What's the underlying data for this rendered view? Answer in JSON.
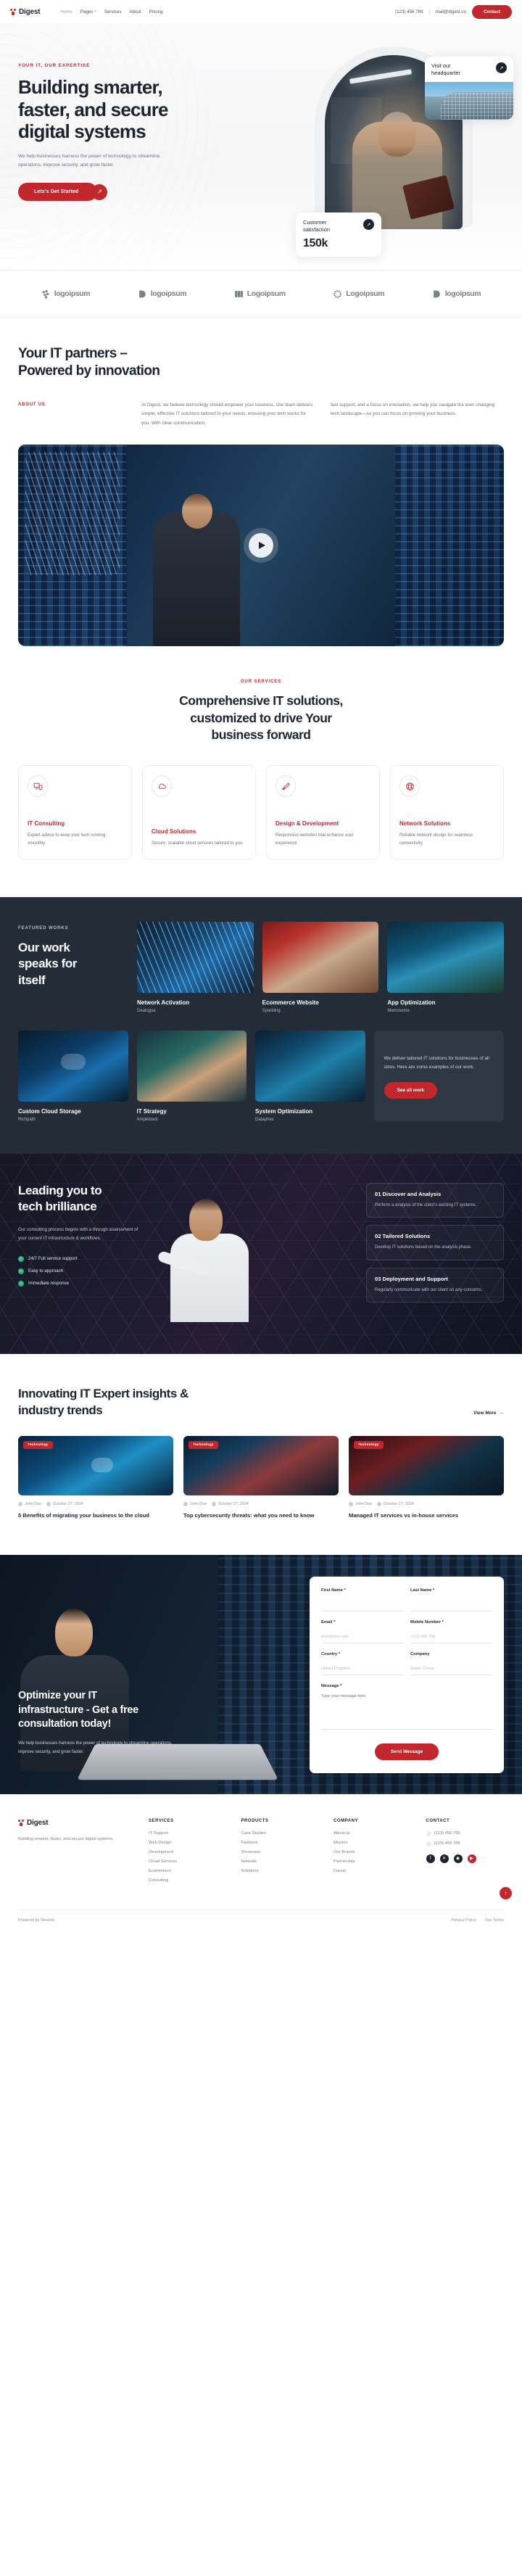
{
  "brand": {
    "name": "Digest",
    "logo_icon": "digest-logo-icon"
  },
  "nav": {
    "links": [
      {
        "label": "Home",
        "has_caret": false
      },
      {
        "label": "Pages",
        "has_caret": true
      },
      {
        "label": "Services",
        "has_caret": false
      },
      {
        "label": "About",
        "has_caret": false
      },
      {
        "label": "Pricing",
        "has_caret": false
      }
    ],
    "phone": "(123) 456 789",
    "email": "mail@digest.co",
    "contact_button": "Contact"
  },
  "hero": {
    "eyebrow": "YOUR IT, OUR EXPERTISE",
    "title_line1": "Building smarter,",
    "title_line2": "faster, and secure",
    "title_line3": "digital systems",
    "subtitle": "We help businesses harness the power of technology to streamline operations, improve security, and grow faster.",
    "cta_label": "Lets's Get Started",
    "cta_arrow": "arrow-up-right-icon",
    "hq_card": {
      "title_line1": "Visit our",
      "title_line2": "headquarter",
      "arrow": "arrow-up-right-icon"
    },
    "stat_card": {
      "label_line1": "Customer",
      "label_line2": "satisfaction",
      "value": "150k",
      "arrow": "arrow-up-right-icon"
    }
  },
  "logos": [
    {
      "name": "logoipsum",
      "glyph": "dots-cluster-icon"
    },
    {
      "name": "logoipsum",
      "glyph": "half-circle-icon"
    },
    {
      "name": "Logoipsum",
      "glyph": "chevron-bars-icon"
    },
    {
      "name": "Logoipsum",
      "glyph": "sun-burst-icon"
    },
    {
      "name": "logoipsum",
      "glyph": "half-circle-icon"
    }
  ],
  "about": {
    "title_line1": "Your IT partners –",
    "title_line2": "Powered by innovation",
    "eyebrow": "ABOUT US",
    "paragraph1": "At Digest, we believe technology should empower your business. Our team delivers simple, effective IT solutions tailored to your needs, ensuring your tech works for you. With clear communication,",
    "paragraph2": "fast support, and a focus on innovation, we help you navigate the ever-changing tech landscape—so you can focus on growing your business.",
    "video_play": "play-icon"
  },
  "services": {
    "eyebrow": "OUR SERVICES",
    "title_line1": "Comprehensive IT solutions,",
    "title_line2": "customized to drive Your",
    "title_line3": "business forward",
    "cards": [
      {
        "icon": "monitor-device-icon",
        "name": "IT Consulting",
        "desc": "Expert advice to keep your tech running smoothly"
      },
      {
        "icon": "cloud-icon",
        "name": "Cloud Solutions",
        "desc": "Secure, scalable cloud services tailored to you"
      },
      {
        "icon": "paintbrush-icon",
        "name": "Design & Development",
        "desc": "Responsive websites that enhance user experience"
      },
      {
        "icon": "globe-icon",
        "name": "Network Solutions",
        "desc": "Reliable network design for seamless connectivity"
      }
    ]
  },
  "works": {
    "eyebrow": "FEATURED WORKS",
    "title_line1": "Our work",
    "title_line2": "speaks for",
    "title_line3": "itself",
    "top_items": [
      {
        "name": "Network Activation",
        "tag": "Dealogue",
        "thumb": "th-net"
      },
      {
        "name": "Ecommerce Website",
        "tag": "Sparkling",
        "thumb": "th-ecom"
      },
      {
        "name": "App Optimization",
        "tag": "Metronome",
        "thumb": "th-app"
      }
    ],
    "bottom_items": [
      {
        "name": "Custom Cloud Storage",
        "tag": "Richpath",
        "thumb": "th-cloud"
      },
      {
        "name": "IT Strategy",
        "tag": "Ampleback",
        "thumb": "th-strategy"
      },
      {
        "name": "System Optimization",
        "tag": "Dataphex",
        "thumb": "th-sys"
      }
    ],
    "promo_text": "We deliver tailored IT solutions for businesses of all sizes. Here are some examples of our work.",
    "promo_button": "See all work"
  },
  "brilliance": {
    "title_line1": "Leading you to",
    "title_line2": "tech brilliance",
    "subtitle": "Our consulting process begins with a through assessment of your current IT infrastructure & workflows.",
    "bullets": [
      "24/7 Full service support",
      "Easy to approach",
      "Immediate response"
    ],
    "check_icon": "check-circle-icon",
    "steps": [
      {
        "title": "01 Discover and Analysis",
        "desc": "Perform a analysis of the client's existing IT systems."
      },
      {
        "title": "02 Tailored Solutions",
        "desc": "Develop IT solutions based on the analysis phase."
      },
      {
        "title": "03 Deployment and Support",
        "desc": "Regularly communicate with our client on any concerns."
      }
    ]
  },
  "blog": {
    "title_line1": "Innovating IT Expert insights &",
    "title_line2": "industry trends",
    "view_more": "View More",
    "view_more_icon": "arrow-right-icon",
    "posts": [
      {
        "badge": "Technology",
        "author": "John Doe",
        "date": "October 27, 2024",
        "title": "5 Benefits of migrating your business to the cloud",
        "thumb": "bt1",
        "author_icon": "user-icon",
        "date_icon": "calendar-icon"
      },
      {
        "badge": "Technology",
        "author": "John Doe",
        "date": "October 27, 2024",
        "title": "Top cybersecurity threats: what you need to know",
        "thumb": "bt2",
        "author_icon": "user-icon",
        "date_icon": "calendar-icon"
      },
      {
        "badge": "Technology",
        "author": "John Doe",
        "date": "October 27, 2024",
        "title": "Managed IT services vs in-house services",
        "thumb": "bt3",
        "author_icon": "user-icon",
        "date_icon": "calendar-icon"
      }
    ]
  },
  "cta": {
    "title_line1": "Optimize your IT",
    "title_line2": "infrastructure - Get a free",
    "title_line3": "consultation today!",
    "subtitle": "We help businesses harness the power of technology to streamline operations, improve security, and grow faster.",
    "form": {
      "first_name_label": "First Name *",
      "first_name_placeholder": "",
      "last_name_label": "Last Name *",
      "last_name_placeholder": "",
      "email_label": "Email *",
      "email_placeholder": "john@doe.com",
      "mobile_label": "Mobile Number *",
      "mobile_placeholder": "+123 456 789",
      "country_label": "Country *",
      "country_placeholder": "United Kingdom",
      "company_label": "Company",
      "company_placeholder": "Martin Group",
      "message_label": "Message *",
      "message_placeholder": "Type your message here",
      "submit_label": "Send Message"
    }
  },
  "footer": {
    "brand": "Digest",
    "about": "Building smarter, faster, and secure digital systems.",
    "columns": [
      {
        "heading": "SERVICES",
        "items": [
          "IT Support",
          "Web Design",
          "Development",
          "Cloud Services",
          "Ecommerce",
          "Consulting"
        ]
      },
      {
        "heading": "PRODUCTS",
        "items": [
          "Case Studies",
          "Features",
          "Showcase",
          "Network",
          "Solutions"
        ]
      },
      {
        "heading": "COMPANY",
        "items": [
          "About us",
          "Mission",
          "Our Brands",
          "Partnership",
          "Career"
        ]
      }
    ],
    "contact": {
      "heading": "CONTACT",
      "items": [
        {
          "icon": "phone-icon",
          "text": "(123) 456 789"
        },
        {
          "icon": "phone-icon",
          "text": "(123) 456 788"
        }
      ],
      "socials": [
        {
          "icon": "facebook-icon",
          "glyph": "f",
          "cls": "fb"
        },
        {
          "icon": "twitter-x-icon",
          "glyph": "✕",
          "cls": "x"
        },
        {
          "icon": "instagram-icon",
          "glyph": "◉",
          "cls": "ig"
        },
        {
          "icon": "youtube-icon",
          "glyph": "▶",
          "cls": "yt"
        }
      ]
    },
    "copyright": "Powered by Nexodе",
    "legal": [
      "Privacy Policy",
      "Our Terms"
    ],
    "scroll_top_icon": "arrow-up-icon"
  },
  "colors": {
    "accent": "#c1272d",
    "dark": "#242c38",
    "ink": "#1d2430",
    "muted": "#6b7280"
  }
}
